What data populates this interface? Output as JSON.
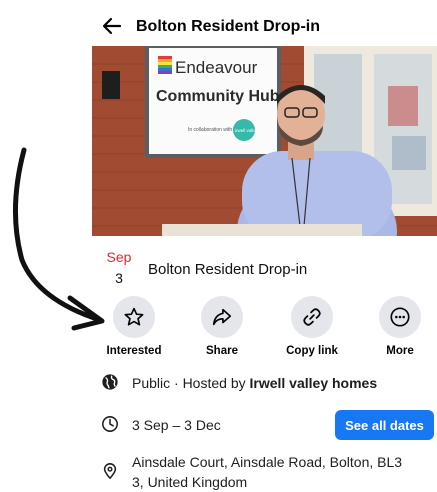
{
  "header": {
    "title": "Bolton Resident Drop-in"
  },
  "cover": {
    "sign_line1": "Endeavour",
    "sign_line2": "Community Hub",
    "sign_small": "In collaboration with",
    "badge_text": "irwell valley"
  },
  "event": {
    "month": "Sep",
    "day": "3",
    "name": "Bolton Resident Drop-in"
  },
  "actions": [
    {
      "label": "Interested",
      "icon": "star-icon"
    },
    {
      "label": "Share",
      "icon": "share-icon"
    },
    {
      "label": "Copy link",
      "icon": "link-icon"
    },
    {
      "label": "More",
      "icon": "more-icon"
    }
  ],
  "info": {
    "privacy": "Public · Hosted by ",
    "host": "Irwell valley homes",
    "dates": "3 Sep – 3 Dec",
    "see_all": "See all dates",
    "address_line1": "Ainsdale Court, Ainsdale Road, Bolton, BL3",
    "address_line2": "3, United Kingdom"
  },
  "colors": {
    "accent": "#1877f2",
    "month_red": "#e4272f",
    "button_bg": "#e4e6eb"
  }
}
